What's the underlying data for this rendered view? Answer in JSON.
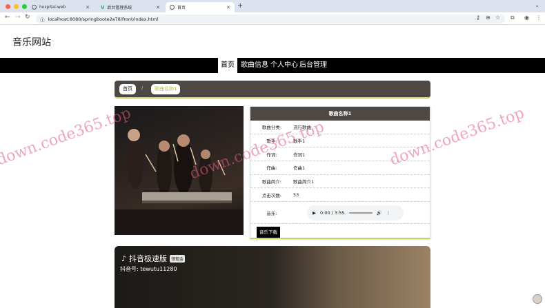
{
  "browser": {
    "tabs": [
      {
        "label": "hospital-web"
      },
      {
        "label": "后台管理系统"
      },
      {
        "label": "首页"
      }
    ],
    "url": "localhost:8080/springboote2a78/front/index.html"
  },
  "site": {
    "title": "音乐网站",
    "nav": [
      "首页",
      "歌曲信息",
      "个人中心",
      "后台管理"
    ]
  },
  "breadcrumb": {
    "home": "首页",
    "sep": "/",
    "current": "歌曲名称1"
  },
  "song": {
    "header": "歌曲名称1",
    "rows": [
      {
        "label": "歌曲分类:",
        "value": "流行歌曲"
      },
      {
        "label": "歌手:",
        "value": "歌手1"
      },
      {
        "label": "作词:",
        "value": "作词1"
      },
      {
        "label": "作曲:",
        "value": "作曲1"
      },
      {
        "label": "歌曲简介:",
        "value": "歌曲简介1"
      },
      {
        "label": "点击次数:",
        "value": "53"
      }
    ],
    "music_label": "音乐:",
    "player": {
      "time": "0:00 / 3:55"
    },
    "download": "音乐下载"
  },
  "ad": {
    "title": "抖音极速版",
    "tag": "领现金",
    "id": "抖音号: tewutu11280"
  },
  "watermark": "down.code365.top",
  "colors": {
    "dark": "#4d4843",
    "accent": "#c6d36a",
    "nav": "#000000"
  }
}
